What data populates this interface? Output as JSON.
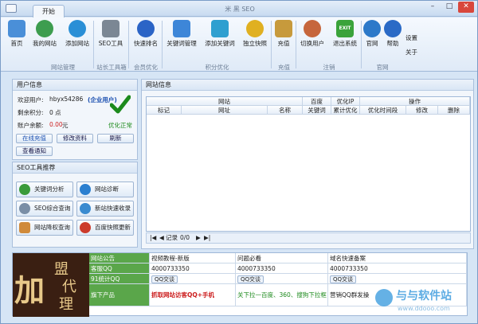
{
  "window": {
    "title": "米 黑 SEO",
    "tab": "开始",
    "controls": [
      "–",
      "□",
      "✕"
    ]
  },
  "ribbon": {
    "buttons": [
      {
        "label": "首页",
        "color": "#4a8fd8"
      },
      {
        "label": "我的网站",
        "color": "#3d9d4f"
      },
      {
        "label": "添加网站",
        "color": "#2a8fd6"
      },
      {
        "label": "SEO工具",
        "color": "#7b8794"
      },
      {
        "label": "快速排名",
        "color": "#2b64c6"
      },
      {
        "label": "关键词管理",
        "color": "#3d86d8"
      },
      {
        "label": "添加关键词",
        "color": "#2f9fd0"
      },
      {
        "label": "独立快照",
        "color": "#e0b021"
      },
      {
        "label": "充值",
        "color": "#c79a3c"
      },
      {
        "label": "切换用户",
        "color": "#c6663c"
      },
      {
        "label": "退出系统",
        "color": "#3aa33a"
      },
      {
        "label": "官网",
        "color": "#2c79c9"
      },
      {
        "label": "帮助",
        "color": "#2a6ac6"
      }
    ],
    "extra": [
      "设置",
      "关于"
    ],
    "exit_text": "EXIT",
    "groups": [
      "网站管理",
      "站长工具箱",
      "会员优化",
      "积分优化",
      "充值",
      "注销",
      "官网"
    ]
  },
  "user_panel": {
    "title": "用户信息",
    "welcome_label": "欢迎用户:",
    "username": "hbyx54286",
    "user_type": "(企业用户)",
    "points_label": "剩余积分:",
    "points_value": "0 点",
    "balance_label": "账户余额:",
    "balance_value": "0.00",
    "balance_unit": "元",
    "status": "优化正常",
    "buttons": [
      "在线充值",
      "修改资料",
      "刷新",
      "查看通知"
    ]
  },
  "seo_panel": {
    "title": "SEO工具推荐",
    "tools": [
      {
        "label": "关键词分析",
        "color": "#3a9b3a"
      },
      {
        "label": "网站诊断",
        "color": "#2a7fd0"
      },
      {
        "label": "SEO综合查询",
        "color": "#7a8ea6"
      },
      {
        "label": "新站快速收录",
        "color": "#3a8bd0"
      },
      {
        "label": "网站降权查询",
        "color": "#d08a3a"
      },
      {
        "label": "百度快照更新",
        "color": "#cc3b2b"
      }
    ]
  },
  "site_panel": {
    "title": "网站信息",
    "group_headers": [
      "网站",
      "百度",
      "优化IP",
      "操作"
    ],
    "columns": [
      "标记",
      "网址",
      "名称",
      "关键词",
      "累计优化",
      "优化时间段",
      "修改",
      "删除"
    ],
    "record_label": "记录",
    "record_value": "0/0",
    "nav": [
      "|◀",
      "◀",
      "▶",
      "▶|"
    ]
  },
  "bottom": {
    "promo": [
      "加",
      "盟",
      "代",
      "理"
    ],
    "rows": [
      {
        "label": "网站公告",
        "c1": "视频教程-新版",
        "c2": "问题必看",
        "c3": "域名快速备案"
      },
      {
        "label": "客服QQ",
        "c1": "4000733350",
        "c2": "4000733350",
        "c3": "4000733350"
      },
      {
        "label": "91统计QQ",
        "c1": "QQ交谈",
        "c2": "QQ交谈",
        "c3": "QQ交谈"
      },
      {
        "label": "旗下产品",
        "c1": "抓取网站访客QQ+手机",
        "c2": "关下拉一百度、360、搜狗下拉框",
        "c3": "营销QQ群发操"
      }
    ]
  },
  "watermark": {
    "text": "与与软件站",
    "sub": "www.ddooo.com"
  },
  "colors": {
    "accent": "#cc1e1e",
    "green": "#1c8a1c",
    "link": "#1a4fb0"
  }
}
